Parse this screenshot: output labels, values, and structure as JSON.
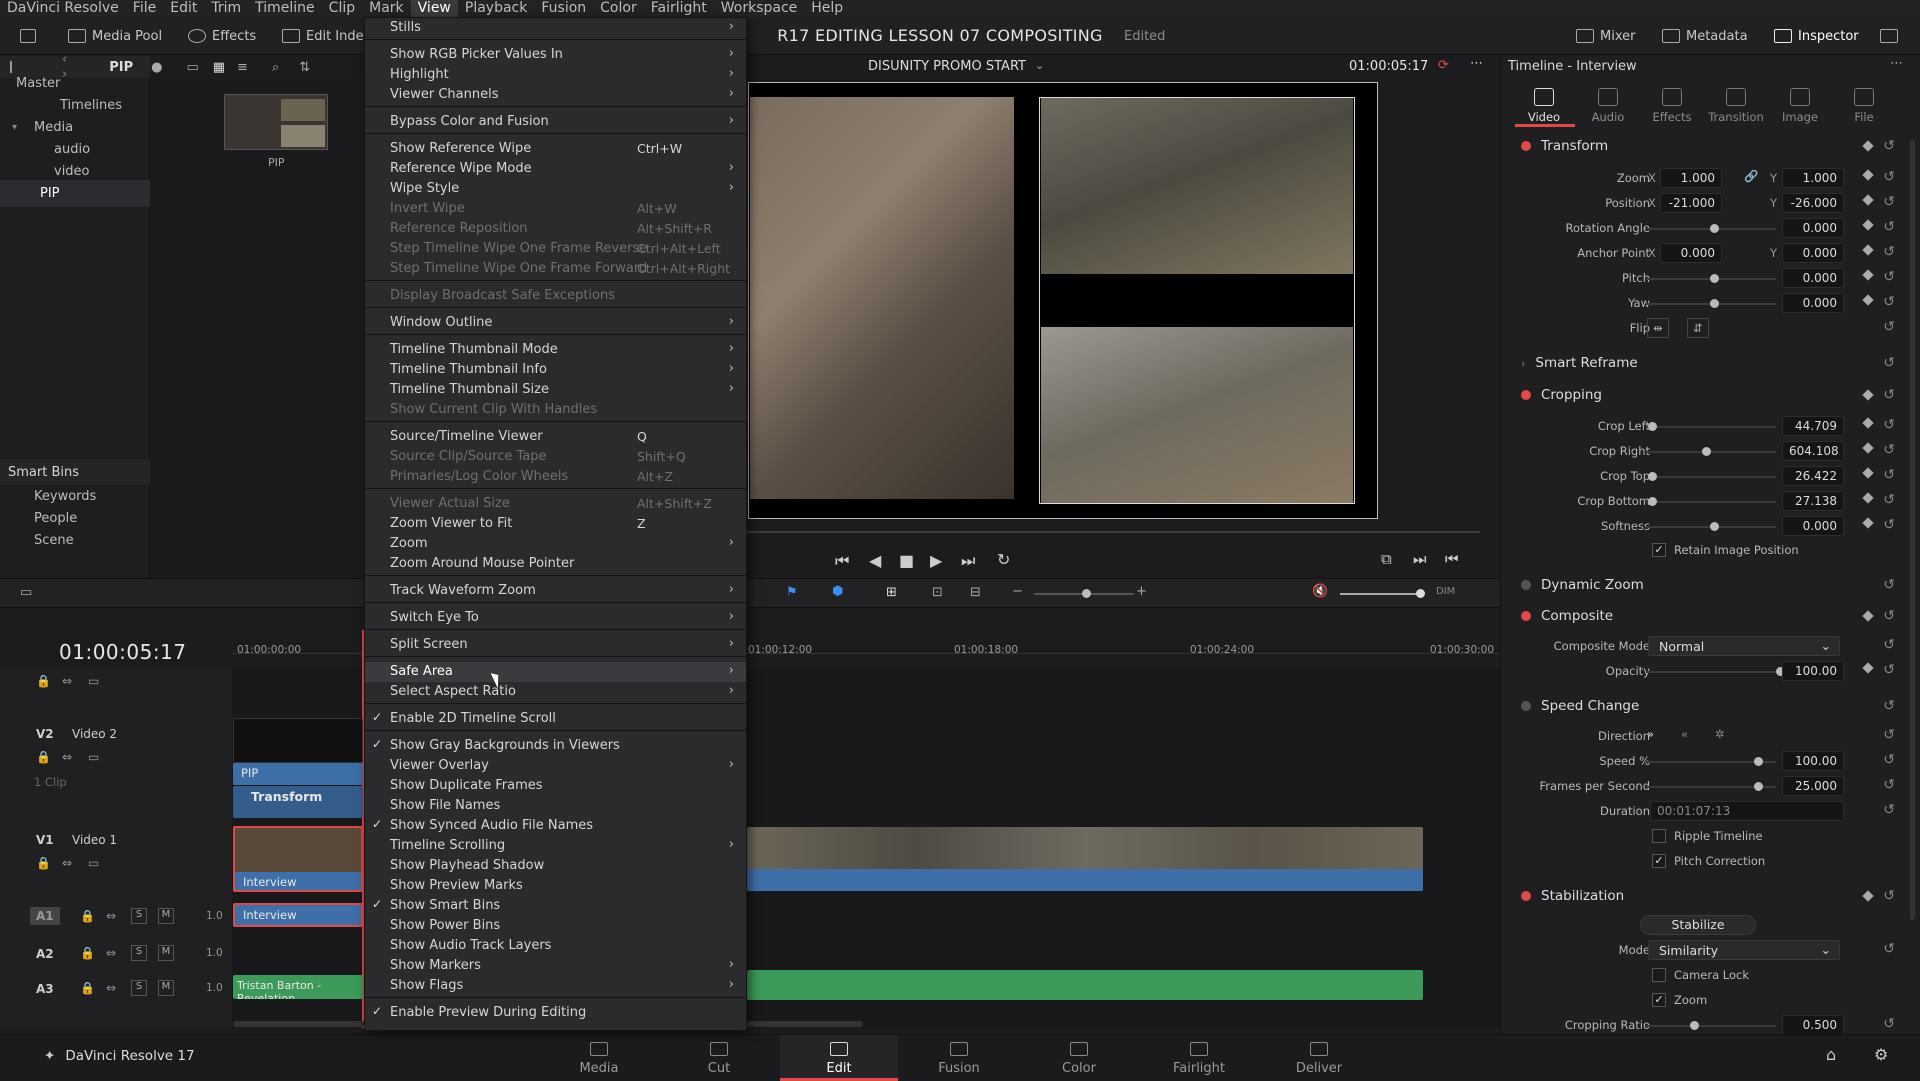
{
  "menubar": [
    "DaVinci Resolve",
    "File",
    "Edit",
    "Trim",
    "Timeline",
    "Clip",
    "Mark",
    "View",
    "Playback",
    "Fusion",
    "Color",
    "Fairlight",
    "Workspace",
    "Help"
  ],
  "menubar_active": "View",
  "toolbar": {
    "media_pool": "Media Pool",
    "effects": "Effects",
    "edit_index": "Edit Index",
    "mixer": "Mixer",
    "metadata": "Metadata",
    "inspector": "Inspector"
  },
  "project": {
    "title": "R17 EDITING LESSON 07 COMPOSITING",
    "status": "Edited"
  },
  "bin_bar": {
    "name": "PIP"
  },
  "media_tree": [
    {
      "label": "Master"
    },
    {
      "label": "Timelines"
    },
    {
      "label": "Media"
    },
    {
      "label": "audio"
    },
    {
      "label": "video"
    },
    {
      "label": "PIP"
    }
  ],
  "smart_bins": {
    "title": "Smart Bins",
    "items": [
      "Keywords",
      "People",
      "Scene"
    ]
  },
  "pip_clip_label": "PIP",
  "viewer": {
    "name": "DISUNITY PROMO START",
    "timecode": "01:00:05:17"
  },
  "view_menu": [
    {
      "label": "Stills",
      "sub": true
    },
    {
      "sep": true
    },
    {
      "label": "Show RGB Picker Values In",
      "sub": true
    },
    {
      "label": "Highlight",
      "sub": true
    },
    {
      "label": "Viewer Channels",
      "sub": true
    },
    {
      "sep": true
    },
    {
      "label": "Bypass Color and Fusion",
      "sub": true
    },
    {
      "sep": true
    },
    {
      "label": "Show Reference Wipe",
      "key": "Ctrl+W"
    },
    {
      "label": "Reference Wipe Mode",
      "sub": true
    },
    {
      "label": "Wipe Style",
      "sub": true
    },
    {
      "label": "Invert Wipe",
      "key": "Alt+W",
      "disabled": true
    },
    {
      "label": "Reference Reposition",
      "key": "Alt+Shift+R",
      "disabled": true
    },
    {
      "label": "Step Timeline Wipe One Frame Reverse",
      "key": "Ctrl+Alt+Left",
      "disabled": true
    },
    {
      "label": "Step Timeline Wipe One Frame Forward",
      "key": "Ctrl+Alt+Right",
      "disabled": true
    },
    {
      "sep": true
    },
    {
      "label": "Display Broadcast Safe Exceptions",
      "disabled": true
    },
    {
      "sep": true
    },
    {
      "label": "Window Outline",
      "sub": true
    },
    {
      "sep": true
    },
    {
      "label": "Timeline Thumbnail Mode",
      "sub": true
    },
    {
      "label": "Timeline Thumbnail Info",
      "sub": true
    },
    {
      "label": "Timeline Thumbnail Size",
      "sub": true
    },
    {
      "label": "Show Current Clip With Handles",
      "disabled": true
    },
    {
      "sep": true
    },
    {
      "label": "Source/Timeline Viewer",
      "key": "Q"
    },
    {
      "label": "Source Clip/Source Tape",
      "key": "Shift+Q",
      "disabled": true
    },
    {
      "label": "Primaries/Log Color Wheels",
      "key": "Alt+Z",
      "disabled": true
    },
    {
      "sep": true
    },
    {
      "label": "Viewer Actual Size",
      "key": "Alt+Shift+Z",
      "disabled": true
    },
    {
      "label": "Zoom Viewer to Fit",
      "key": "Z"
    },
    {
      "label": "Zoom",
      "sub": true
    },
    {
      "label": "Zoom Around Mouse Pointer"
    },
    {
      "sep": true
    },
    {
      "label": "Track Waveform Zoom",
      "sub": true
    },
    {
      "sep": true
    },
    {
      "label": "Switch Eye To",
      "sub": true
    },
    {
      "sep": true
    },
    {
      "label": "Split Screen",
      "sub": true
    },
    {
      "sep": true
    },
    {
      "label": "Safe Area",
      "sub": true,
      "highlight": true
    },
    {
      "label": "Select Aspect Ratio",
      "sub": true
    },
    {
      "sep": true
    },
    {
      "label": "Enable 2D Timeline Scroll",
      "check": true
    },
    {
      "sep": true
    },
    {
      "label": "Show Gray Backgrounds in Viewers",
      "check": true
    },
    {
      "label": "Viewer Overlay",
      "sub": true
    },
    {
      "label": "Show Duplicate Frames"
    },
    {
      "label": "Show File Names"
    },
    {
      "label": "Show Synced Audio File Names",
      "check": true
    },
    {
      "label": "Timeline Scrolling",
      "sub": true
    },
    {
      "label": "Show Playhead Shadow"
    },
    {
      "label": "Show Preview Marks"
    },
    {
      "label": "Show Smart Bins",
      "check": true
    },
    {
      "label": "Show Power Bins"
    },
    {
      "label": "Show Audio Track Layers"
    },
    {
      "label": "Show Markers",
      "sub": true
    },
    {
      "label": "Show Flags",
      "sub": true
    },
    {
      "sep": true
    },
    {
      "label": "Enable Preview During Editing",
      "check": true
    }
  ],
  "inspector": {
    "title": "Timeline - Interview",
    "tabs": [
      "Video",
      "Audio",
      "Effects",
      "Transition",
      "Image",
      "File"
    ],
    "transform": {
      "title": "Transform",
      "zoom_label": "Zoom",
      "zoom_x": "1.000",
      "zoom_y": "1.000",
      "position_label": "Position",
      "position_x": "-21.000",
      "position_y": "-26.000",
      "rotation_label": "Rotation Angle",
      "rotation": "0.000",
      "anchor_label": "Anchor Point",
      "anchor_x": "0.000",
      "anchor_y": "0.000",
      "pitch_label": "Pitch",
      "pitch": "0.000",
      "yaw_label": "Yaw",
      "yaw": "0.000",
      "flip_label": "Flip",
      "x": "X",
      "y": "Y"
    },
    "smart_reframe": "Smart Reframe",
    "cropping": {
      "title": "Cropping",
      "left_label": "Crop Left",
      "left": "44.709",
      "right_label": "Crop Right",
      "right": "604.108",
      "top_label": "Crop Top",
      "top": "26.422",
      "bottom_label": "Crop Bottom",
      "bottom": "27.138",
      "softness_label": "Softness",
      "softness": "0.000",
      "retain": "Retain Image Position"
    },
    "dynamic_zoom": "Dynamic Zoom",
    "composite": {
      "title": "Composite",
      "mode_label": "Composite Mode",
      "mode": "Normal",
      "opacity_label": "Opacity",
      "opacity": "100.00"
    },
    "speed": {
      "title": "Speed Change",
      "direction_label": "Direction",
      "speed_label": "Speed %",
      "speed": "100.00",
      "fps_label": "Frames per Second",
      "fps": "25.000",
      "duration_label": "Duration",
      "duration": "00:01:07:13",
      "ripple": "Ripple Timeline",
      "pitch": "Pitch Correction"
    },
    "stabilization": {
      "title": "Stabilization",
      "button": "Stabilize",
      "mode_label": "Mode",
      "mode": "Similarity",
      "camera_lock": "Camera Lock",
      "zoom": "Zoom",
      "ratio_label": "Cropping Ratio",
      "ratio": "0.500"
    }
  },
  "timeline": {
    "timecode": "01:00:05:17",
    "ruler": [
      "01:00:00:00",
      "01:00:12:00",
      "01:00:18:00",
      "01:00:24:00",
      "01:00:30:00"
    ],
    "tracks": [
      {
        "id": "V2",
        "name": "Video 2",
        "info": "1 Clip"
      },
      {
        "id": "V1",
        "name": "Video 1"
      },
      {
        "id": "A1",
        "level": "1.0"
      },
      {
        "id": "A2",
        "level": "1.0"
      },
      {
        "id": "A3",
        "level": "1.0"
      }
    ],
    "solo": "S",
    "mute": "M",
    "clips": {
      "pip": "PIP",
      "transform": "Transform",
      "interview_v": "Interview",
      "interview_a": "Interview",
      "music": "Tristan Barton - Revelation"
    }
  },
  "pages": [
    "Media",
    "Cut",
    "Edit",
    "Fusion",
    "Color",
    "Fairlight",
    "Deliver"
  ],
  "active_page": "Edit",
  "app_name": "DaVinci Resolve 17",
  "colors": {
    "accent": "#e14848",
    "timeline_blue": "#3e6fa8",
    "audio_green": "#3c9a5a"
  }
}
